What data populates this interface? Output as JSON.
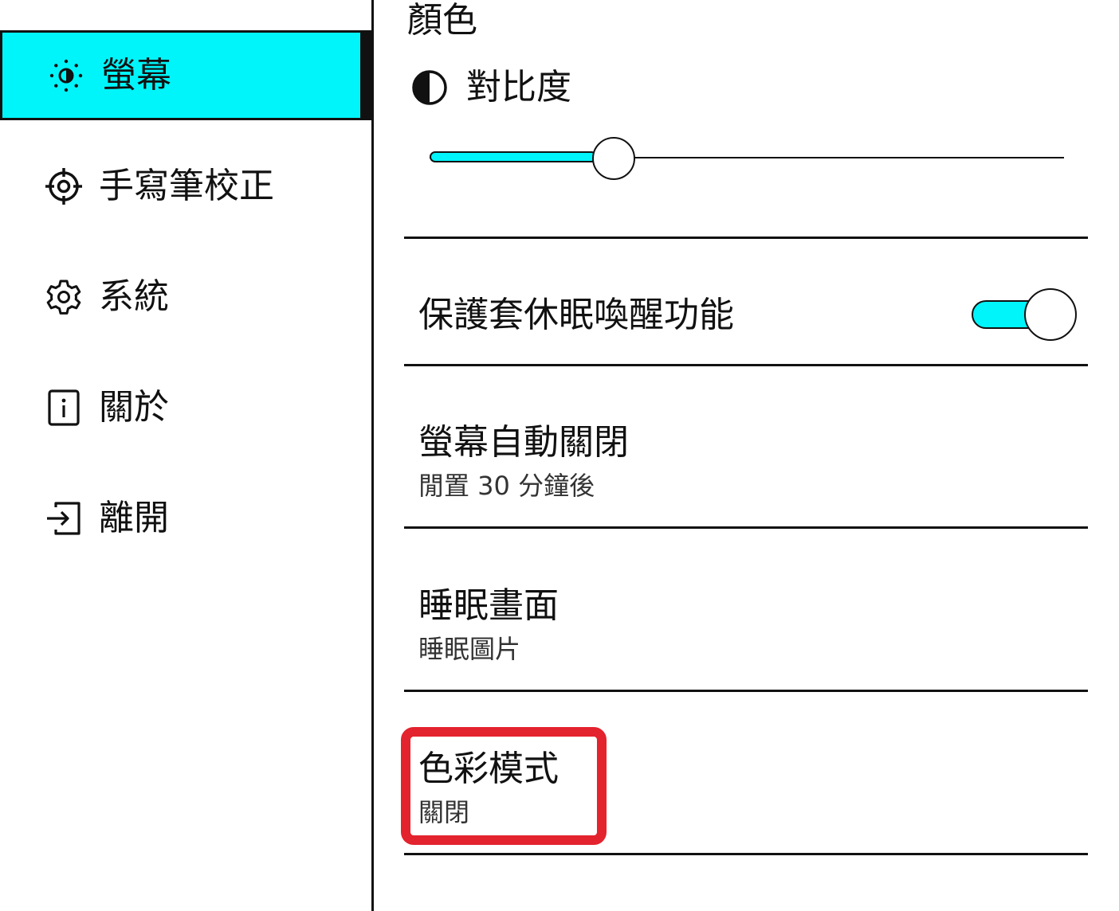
{
  "sidebar": {
    "items": [
      {
        "label": "螢幕",
        "icon": "brightness-icon",
        "active": true
      },
      {
        "label": "手寫筆校正",
        "icon": "crosshair-icon",
        "active": false
      },
      {
        "label": "系統",
        "icon": "gear-icon",
        "active": false
      },
      {
        "label": "關於",
        "icon": "info-icon",
        "active": false
      },
      {
        "label": "離開",
        "icon": "exit-icon",
        "active": false
      }
    ]
  },
  "main": {
    "section_heading": "顏色",
    "contrast": {
      "label": "對比度",
      "icon": "contrast-icon",
      "value": 0.29
    },
    "cover_sleep": {
      "label": "保護套休眠喚醒功能",
      "enabled": true
    },
    "screen_auto_off": {
      "title": "螢幕自動關閉",
      "subtitle": "閒置 30 分鐘後"
    },
    "sleep_screen": {
      "title": "睡眠畫面",
      "subtitle": "睡眠圖片"
    },
    "color_mode": {
      "title": "色彩模式",
      "subtitle": "關閉"
    }
  },
  "colors": {
    "accent": "#00f5fa",
    "highlight": "#e3232e",
    "text": "#111111",
    "background": "#ffffff"
  }
}
